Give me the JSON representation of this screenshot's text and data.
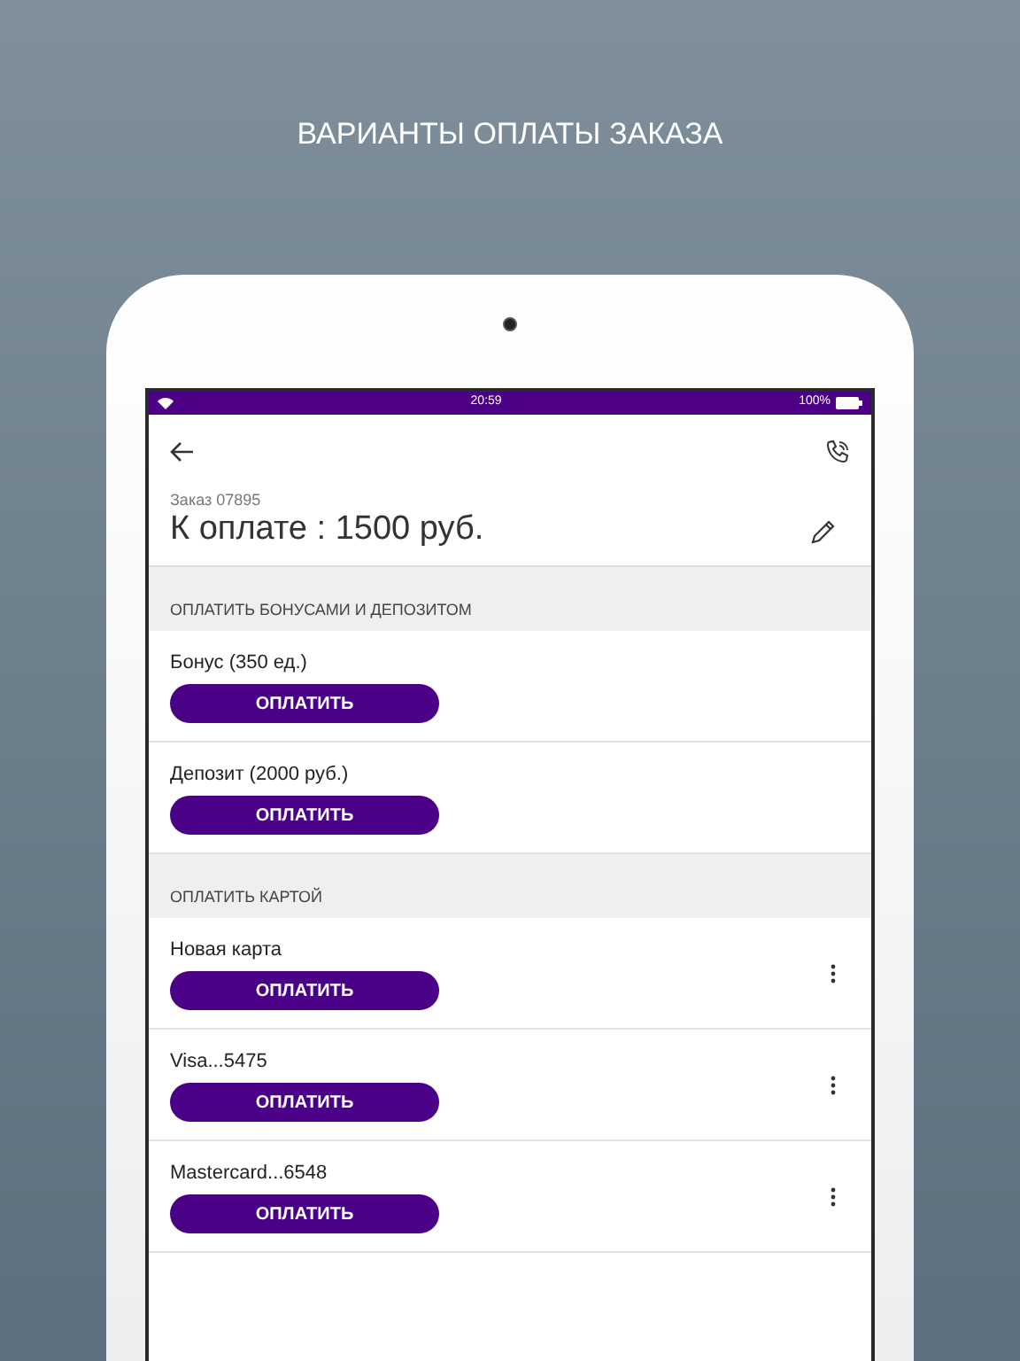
{
  "heading": "ВАРИАНТЫ ОПЛАТЫ ЗАКАЗА",
  "status_bar": {
    "time": "20:59",
    "battery": "100%"
  },
  "order": {
    "number": "Заказ 07895",
    "amount": "К оплате : 1500 руб."
  },
  "sections": [
    {
      "title": "ОПЛАТИТЬ БОНУСАМИ И ДЕПОЗИТОМ",
      "options": [
        {
          "label": "Бонус (350 ед.)",
          "button": "ОПЛАТИТЬ",
          "menu": false
        },
        {
          "label": "Депозит (2000 руб.)",
          "button": "ОПЛАТИТЬ",
          "menu": false
        }
      ]
    },
    {
      "title": "ОПЛАТИТЬ КАРТОЙ",
      "options": [
        {
          "label": "Новая карта",
          "button": "ОПЛАТИТЬ",
          "menu": true
        },
        {
          "label": "Visa...5475",
          "button": "ОПЛАТИТЬ",
          "menu": true
        },
        {
          "label": "Mastercard...6548",
          "button": "ОПЛАТИТЬ",
          "menu": true
        }
      ]
    }
  ]
}
